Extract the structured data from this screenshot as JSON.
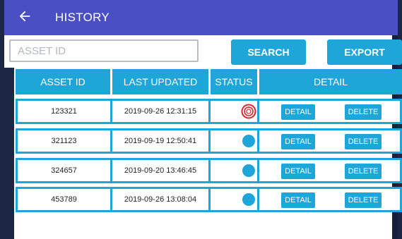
{
  "app": {
    "title": "HISTORY"
  },
  "toolbar": {
    "search_placeholder": "ASSET ID",
    "search_value": "",
    "search_label": "SEARCH",
    "export_label": "EXPORT"
  },
  "table": {
    "headers": [
      "ASSET ID",
      "LAST UPDATED",
      "STATUS",
      "DETAIL"
    ],
    "rows": [
      {
        "asset_id": "123321",
        "last_updated": "2019-09-26 12:31:15",
        "status": "active-ring",
        "detail_label": "DETAIL",
        "delete_label": "DELETE"
      },
      {
        "asset_id": "321123",
        "last_updated": "2019-09-19 12:50:41",
        "status": "dot",
        "detail_label": "DETAIL",
        "delete_label": "DELETE"
      },
      {
        "asset_id": "324657",
        "last_updated": "2019-09-20 13:46:45",
        "status": "dot",
        "detail_label": "DETAIL",
        "delete_label": "DELETE"
      },
      {
        "asset_id": "453789",
        "last_updated": "2019-09-26 13:08:04",
        "status": "dot",
        "detail_label": "DETAIL",
        "delete_label": "DELETE"
      }
    ]
  },
  "colors": {
    "appbar": "#4b4fc4",
    "accent": "#1ea6d8",
    "status_alert": "#d8262e",
    "frame": "#1c2744"
  }
}
